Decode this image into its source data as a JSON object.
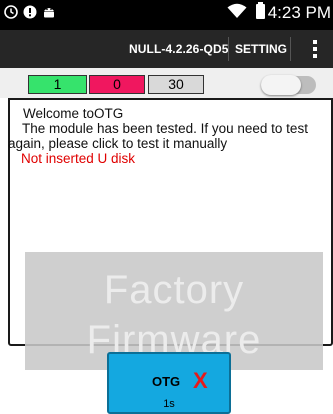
{
  "status_bar": {
    "time": "4:23 PM",
    "icons": [
      "clock-icon",
      "alert-icon",
      "android-icon",
      "wifi-icon",
      "battery-icon"
    ]
  },
  "action_bar": {
    "build": "NULL-4.2.26-QD5",
    "setting_label": "SETTING",
    "menu_icon": "overflow-menu-icon"
  },
  "counters": {
    "pass": "1",
    "fail": "0",
    "total": "30",
    "colors": {
      "pass": "#36e36c",
      "fail": "#f0175f",
      "total": "#d9d9d9"
    }
  },
  "toggle": {
    "state": "off"
  },
  "log": {
    "welcome": "Welcome toOTG",
    "tested_line1": "The module has been tested. If you need to test",
    "tested_line2": "again, please click to test it manually",
    "error": "Not inserted U disk",
    "error_color": "#e00000"
  },
  "watermark": {
    "line1": "Factory",
    "line2": "Firmware"
  },
  "otg_button": {
    "label": "OTG",
    "result": "X",
    "time": "1s",
    "color": "#14a8e0"
  }
}
